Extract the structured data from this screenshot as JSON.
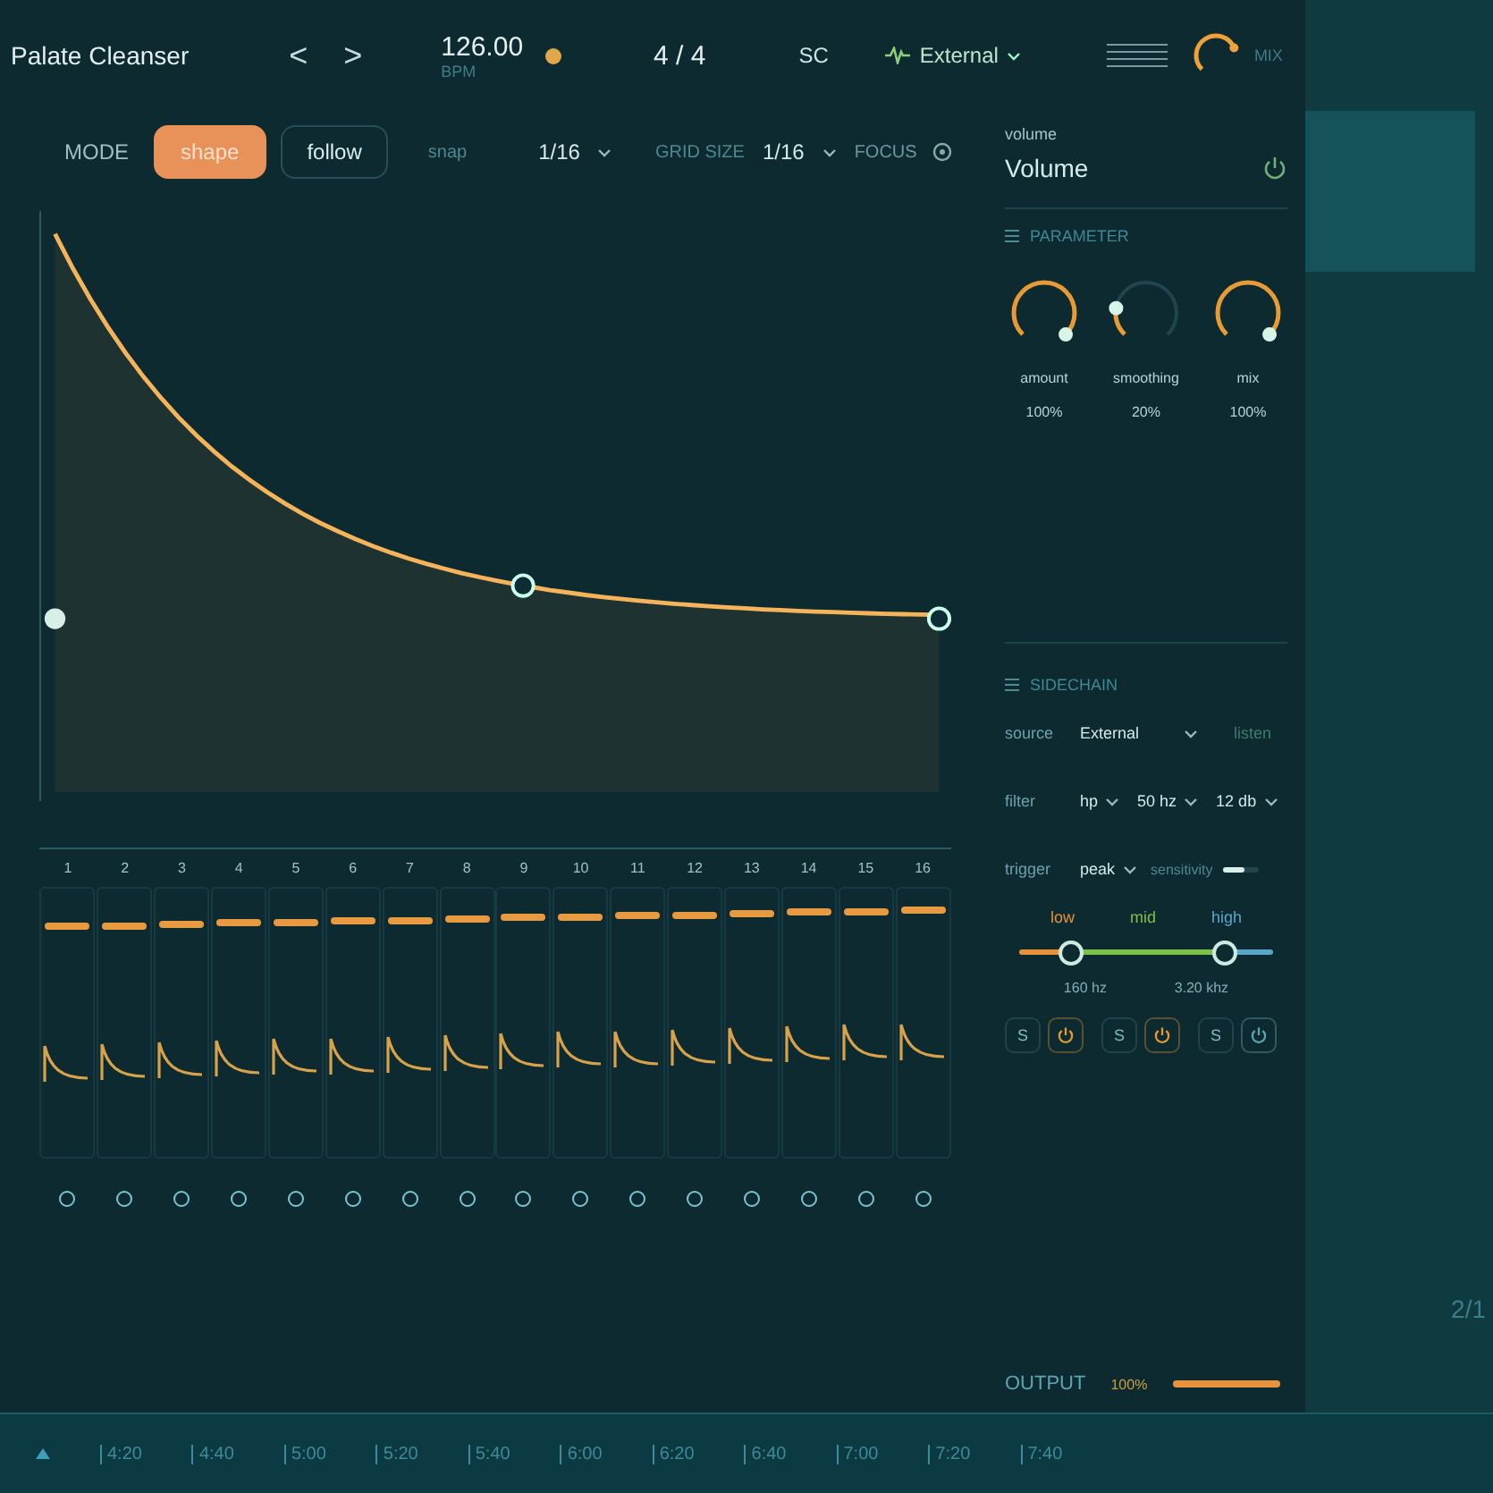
{
  "header": {
    "title": "Palate Cleanser",
    "prev": "<",
    "next": ">",
    "tempo": "126.00",
    "tempo_unit": "BPM",
    "time_signature": "4 / 4",
    "sc_label": "SC",
    "sc_source": "External",
    "mix_label": "MIX"
  },
  "toolbar": {
    "mode_label": "MODE",
    "modes": [
      {
        "label": "shape",
        "selected": true
      },
      {
        "label": "follow",
        "selected": false
      }
    ],
    "snap_label": "snap",
    "snap_value": "1/16",
    "grid_label": "GRID SIZE",
    "grid_value": "1/16",
    "focus_label": "FOCUS"
  },
  "steps": [
    {
      "number": "1",
      "level": 0.84
    },
    {
      "number": "2",
      "level": 0.845
    },
    {
      "number": "3",
      "level": 0.85
    },
    {
      "number": "4",
      "level": 0.855
    },
    {
      "number": "5",
      "level": 0.86
    },
    {
      "number": "6",
      "level": 0.865
    },
    {
      "number": "7",
      "level": 0.87
    },
    {
      "number": "8",
      "level": 0.875
    },
    {
      "number": "9",
      "level": 0.88
    },
    {
      "number": "10",
      "level": 0.885
    },
    {
      "number": "11",
      "level": 0.89
    },
    {
      "number": "12",
      "level": 0.895
    },
    {
      "number": "13",
      "level": 0.9
    },
    {
      "number": "14",
      "level": 0.905
    },
    {
      "number": "15",
      "level": 0.91
    },
    {
      "number": "16",
      "level": 0.915
    }
  ],
  "inspector": {
    "caption": "volume",
    "name": "Volume"
  },
  "parameter": {
    "title": "PARAMETER",
    "knobs": [
      {
        "label": "amount",
        "value": "100%",
        "level": 1
      },
      {
        "label": "smoothing",
        "value": "20%",
        "level": 0.2
      },
      {
        "label": "mix",
        "value": "100%",
        "level": 1
      }
    ]
  },
  "sidechain": {
    "title": "SIDECHAIN",
    "source_label": "source",
    "source_value": "External",
    "listen": "listen",
    "filter_label": "filter",
    "filter_values": [
      "hp",
      "50 hz",
      "12 db"
    ],
    "trigger_label": "trigger",
    "trigger_value": "peak",
    "sensitivity_label": "sensitivity",
    "sensitivity": {
      "level": 0.6
    },
    "bands": [
      {
        "label": "low",
        "color": "#e8913a",
        "solo": "S",
        "on": true
      },
      {
        "label": "mid",
        "color": "#7cc04a",
        "solo": "S",
        "on": true
      },
      {
        "label": "high",
        "color": "#5aa6c8",
        "solo": "S",
        "on": false
      }
    ],
    "crossovers": [
      {
        "value": "160 hz",
        "level": 0.2
      },
      {
        "value": "3.20 khz",
        "level": 0.8
      }
    ]
  },
  "output": {
    "label": "OUTPUT",
    "value": "100%",
    "level": 1
  },
  "timeline": {
    "page": "2/1",
    "marks": [
      "4:20",
      "4:40",
      "5:00",
      "5:20",
      "5:40",
      "6:00",
      "6:20",
      "6:40",
      "7:00",
      "7:20",
      "7:40"
    ]
  }
}
